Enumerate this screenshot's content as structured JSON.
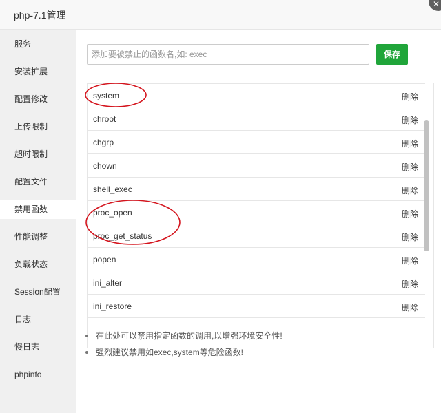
{
  "window": {
    "title": "php-7.1管理"
  },
  "sidebar": {
    "active_index": 6,
    "items": [
      {
        "label": "服务"
      },
      {
        "label": "安装扩展"
      },
      {
        "label": "配置修改"
      },
      {
        "label": "上传限制"
      },
      {
        "label": "超时限制"
      },
      {
        "label": "配置文件"
      },
      {
        "label": "禁用函数"
      },
      {
        "label": "性能调整"
      },
      {
        "label": "负载状态"
      },
      {
        "label": "Session配置"
      },
      {
        "label": "日志"
      },
      {
        "label": "慢日志"
      },
      {
        "label": "phpinfo"
      }
    ]
  },
  "form": {
    "input_placeholder": "添加要被禁止的函数名,如: exec",
    "input_value": "",
    "save_label": "保存"
  },
  "functions": {
    "delete_label": "删除",
    "rows": [
      {
        "name": "system"
      },
      {
        "name": "chroot"
      },
      {
        "name": "chgrp"
      },
      {
        "name": "chown"
      },
      {
        "name": "shell_exec"
      },
      {
        "name": "proc_open"
      },
      {
        "name": "proc_get_status"
      },
      {
        "name": "popen"
      },
      {
        "name": "ini_alter"
      },
      {
        "name": "ini_restore"
      }
    ]
  },
  "help": {
    "items": [
      "在此处可以禁用指定函数的调用,以增强环境安全性!",
      "强烈建议禁用如exec,system等危险函数!"
    ]
  },
  "colors": {
    "accent": "#20a53a",
    "annotation": "#d4141d"
  }
}
